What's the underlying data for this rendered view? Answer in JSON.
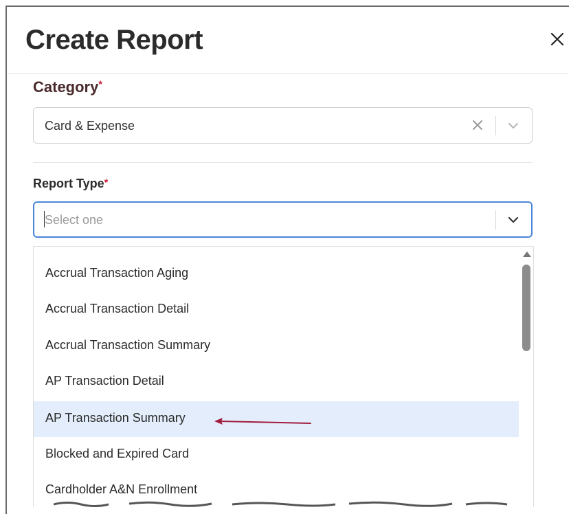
{
  "dialog": {
    "title": "Create Report"
  },
  "category": {
    "label": "Category",
    "required_mark": "*",
    "value": "Card & Expense"
  },
  "report_type": {
    "label": "Report Type",
    "required_mark": "*",
    "placeholder": "Select one"
  },
  "options": [
    {
      "label": "Accrual Transaction Aging",
      "highlighted": false
    },
    {
      "label": "Accrual Transaction Detail",
      "highlighted": false
    },
    {
      "label": "Accrual Transaction Summary",
      "highlighted": false
    },
    {
      "label": "AP Transaction Detail",
      "highlighted": false
    },
    {
      "label": "AP Transaction Summary",
      "highlighted": true
    },
    {
      "label": "Blocked and Expired Card",
      "highlighted": false
    },
    {
      "label": "Cardholder A&N Enrollment",
      "highlighted": false
    }
  ],
  "colors": {
    "focus_border": "#4a86d6",
    "highlight_bg": "#e3edfb",
    "required": "#c8102e",
    "annotation_arrow": "#a01c3c"
  },
  "icons": {
    "close": "close-icon",
    "clear": "clear-x-icon",
    "chevron": "chevron-down-icon",
    "scroll_up": "scroll-up-arrow-icon",
    "annotation": "annotation-arrow-icon"
  }
}
